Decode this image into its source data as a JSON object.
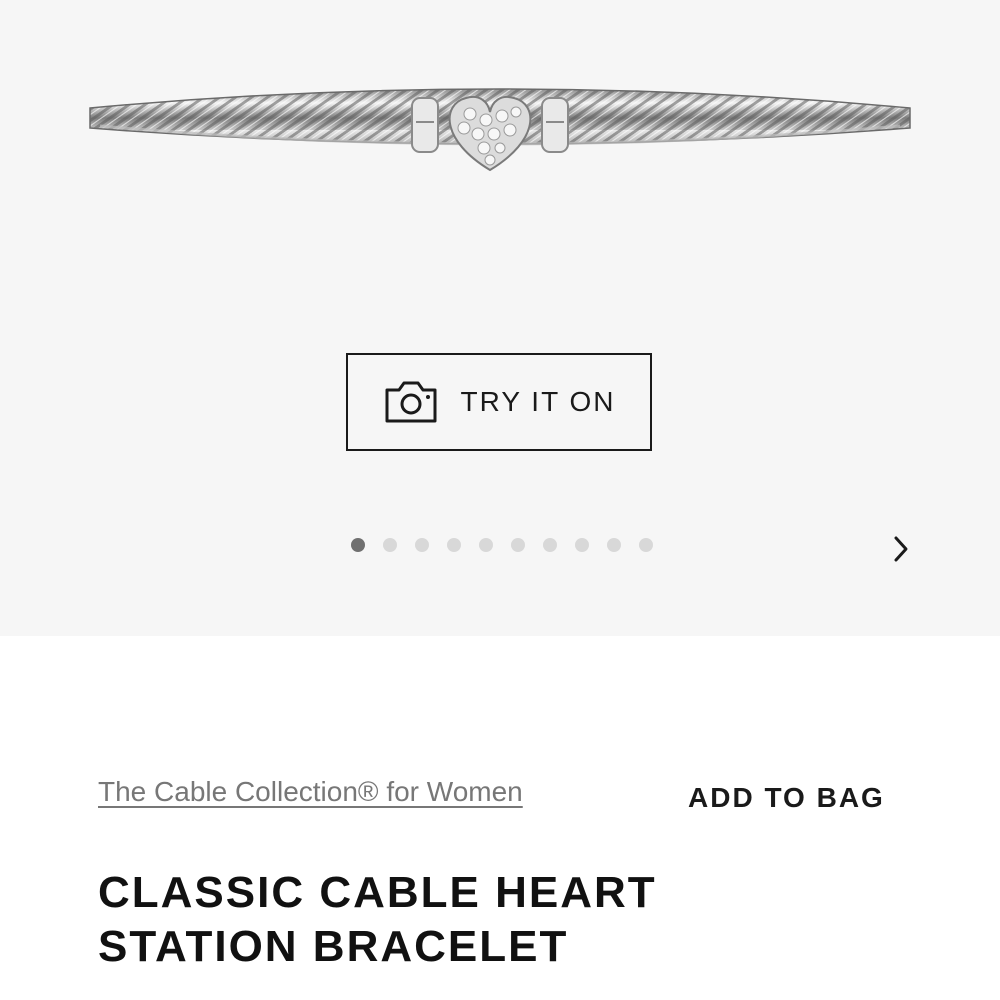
{
  "gallery": {
    "try_on_label": "TRY IT ON",
    "dots_total": 10,
    "active_index": 0,
    "camera_icon": "camera-icon",
    "next_icon": "chevron-right-icon"
  },
  "product": {
    "collection_link": "The Cable Collection® for Women",
    "add_to_bag_label": "ADD TO BAG",
    "title_lines": [
      "CLASSIC CABLE HEART",
      "STATION BRACELET"
    ]
  },
  "colors": {
    "background_gallery": "#f6f6f6",
    "text_primary": "#1a1a1a",
    "link_gray": "#777777",
    "dot_active": "#707070",
    "dot_inactive": "#d8d8d8"
  }
}
